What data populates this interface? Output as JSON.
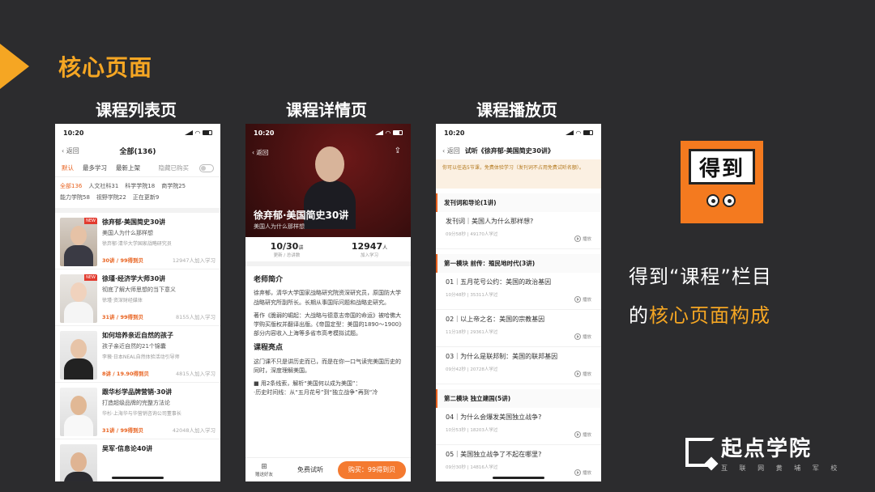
{
  "slide": {
    "title": "核心页面",
    "labels": [
      "课程列表页",
      "课程详情页",
      "课程播放页"
    ],
    "desc_line1": "得到“课程”栏目",
    "desc_line2_prefix": "的",
    "desc_line2_highlight": "核心页面构成",
    "logo_text": "得到",
    "brand_name": "起点学院",
    "brand_tagline": "互 联 网 黄 埔 军 校",
    "accent_color": "#f5a623"
  },
  "list_page": {
    "time": "10:20",
    "back": "返回",
    "title": "全部(136)",
    "sort_tabs": [
      "默认",
      "最多学习",
      "最新上架"
    ],
    "hide_bought": "隐藏已购买",
    "categories": [
      "全部136",
      "人文社科31",
      "科学学院18",
      "商学院25",
      "能力学院58",
      "视野学院22",
      "正在更新9"
    ],
    "courses": [
      {
        "title": "徐弃郁·美国简史30讲",
        "subtitle": "美国人为什么那样想",
        "author": "徐弃郁·清华大学国家战略研究员",
        "price": "30讲 / 99得到贝",
        "count": "12947人加入学习",
        "new": "NEW"
      },
      {
        "title": "徐瑾·经济学大师30讲",
        "subtitle": "彻底了解大师思想的当下意义",
        "author": "徐瑾·资深财经媒体",
        "price": "31讲 / 99得到贝",
        "count": "8155人加入学习",
        "new": "NEW"
      },
      {
        "title": "如何培养亲近自然的孩子",
        "subtitle": "孩子亲近自然的21个锦囊",
        "author": "李薇·日本NEAL自然体验活动引导师",
        "price": "8讲 / 19.90得到贝",
        "count": "4815人加入学习",
        "new": ""
      },
      {
        "title": "跟华杉学品牌营销·30讲",
        "subtitle": "打造超级品牌的完整方法论",
        "author": "华杉·上海华与华营销咨询公司董事长",
        "price": "31讲 / 99得到贝",
        "count": "42048人加入学习",
        "new": ""
      },
      {
        "title": "吴军·信息论40讲",
        "subtitle": "",
        "author": "",
        "price": "",
        "count": "",
        "new": ""
      }
    ]
  },
  "detail_page": {
    "time": "10:20",
    "back": "返回",
    "course_title": "徐弃郁·美国简史30讲",
    "course_subtitle": "美国人为什么那样想",
    "stat1_num": "10/30",
    "stat1_unit": "讲",
    "stat1_label": "更新 / 总讲数",
    "stat2_num": "12947",
    "stat2_unit": "人",
    "stat2_label": "加入学习",
    "teacher_heading": "老师简介",
    "teacher_p1": "徐弃郁，清华大学国家战略研究院资深研究员，原国防大学战略研究所副所长。长期从事国际问题和战略史研究。",
    "teacher_p2": "著作《脆弱的崛起：大战略与德意志帝国的命运》被哈佛大学购买版权并翻译出版。《帝国定型：美国的1890～1900》部分内容收入上海等多省市高考模拟试题。",
    "highlight_heading": "课程亮点",
    "highlight_p1": "这门课不只是讲历史而已，而是在你一口气读完美国历史的同时，深度理解美国。",
    "highlight_p2": "■ 用2条线索，解析“美国何以成为美国”：",
    "highlight_p3": "·历史时间线：从“五月花号”到“独立战争”再到“冷",
    "gift": "赠送好友",
    "try": "免费试听",
    "buy": "购买：99得到贝"
  },
  "play_page": {
    "time": "10:20",
    "back": "返回",
    "title": "试听《徐弃郁·美国简史30讲》",
    "notice": "你可以任选5节课，免费体验学习（发刊词不占用免费试听名额）。",
    "play_label": "播放",
    "groups": [
      {
        "name": "发刊词和导论(1讲)",
        "episodes": [
          {
            "title": "发刊词｜美国人为什么那样想?",
            "meta": "09分58秒 | 49170人学过"
          }
        ]
      },
      {
        "name": "第一模块 前传：殖民地时代(3讲)",
        "episodes": [
          {
            "title": "01｜五月花号公约：美国的政治基因",
            "meta": "10分48秒 | 35311人学过"
          },
          {
            "title": "02｜以上帝之名：美国的宗教基因",
            "meta": "11分18秒 | 29361人学过"
          },
          {
            "title": "03｜为什么是联邦制：美国的联邦基因",
            "meta": "09分42秒 | 20728人学过"
          }
        ]
      },
      {
        "name": "第二模块 独立建国(5讲)",
        "episodes": [
          {
            "title": "04｜为什么会爆发美国独立战争?",
            "meta": "10分53秒 | 18203人学过"
          },
          {
            "title": "05｜美国独立战争了不起在哪里?",
            "meta": "09分30秒 | 14816人学过"
          }
        ]
      }
    ]
  }
}
